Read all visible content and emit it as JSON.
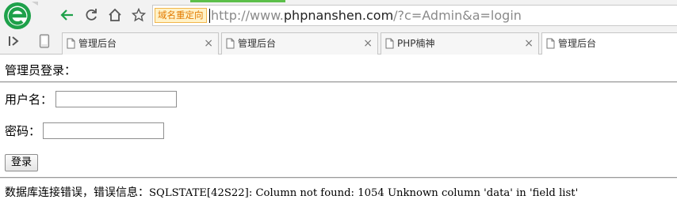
{
  "browser": {
    "logo_icon": "360-browser-logo",
    "nav_icons": [
      "back-arrow",
      "refresh",
      "home",
      "bookmark-star"
    ],
    "redirect_badge": "域名重定向",
    "url": {
      "scheme": "http://www.",
      "host": "phpnanshen.com",
      "path": "/?c=Admin&a=login"
    },
    "accent_color": "#1ea14a",
    "badge_color": "#e27a00",
    "tabs": [
      {
        "label": "管理后台",
        "close": "×"
      },
      {
        "label": "管理后台",
        "close": "×"
      },
      {
        "label": "PHP楠神",
        "close": "×"
      },
      {
        "label": "管理后台",
        "close": ""
      }
    ]
  },
  "page": {
    "title": "管理员登录：",
    "username_label": "用户名：",
    "username_value": "",
    "password_label": "密码：",
    "password_value": "",
    "login_button": "登录",
    "error_prefix": "数据库连接错误，错误信息：",
    "error_message": "SQLSTATE[42S22]: Column not found: 1054 Unknown column 'data' in 'field list'"
  }
}
